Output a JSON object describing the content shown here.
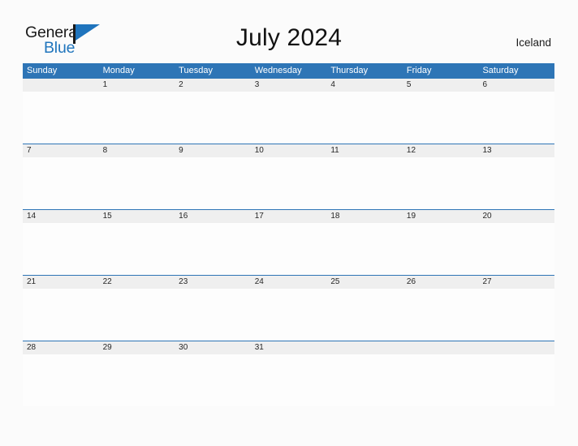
{
  "brand": {
    "name_top": "General",
    "name_bottom": "Blue",
    "flag_icon": "flag-triangle-icon",
    "accent_color": "#1f74bd",
    "dark_color": "#1a1a1a"
  },
  "header": {
    "title": "July 2024",
    "country": "Iceland"
  },
  "theme": {
    "header_blue": "#2e75b6",
    "date_band_gray": "#efefef",
    "page_background": "#fbfbfb",
    "cell_background": "#fdfdfd",
    "text_color": "#262626"
  },
  "calendar": {
    "month": "July",
    "year": "2024",
    "weekdays": [
      "Sunday",
      "Monday",
      "Tuesday",
      "Wednesday",
      "Thursday",
      "Friday",
      "Saturday"
    ],
    "weeks": [
      [
        "",
        "1",
        "2",
        "3",
        "4",
        "5",
        "6"
      ],
      [
        "7",
        "8",
        "9",
        "10",
        "11",
        "12",
        "13"
      ],
      [
        "14",
        "15",
        "16",
        "17",
        "18",
        "19",
        "20"
      ],
      [
        "21",
        "22",
        "23",
        "24",
        "25",
        "26",
        "27"
      ],
      [
        "28",
        "29",
        "30",
        "31",
        "",
        "",
        ""
      ]
    ]
  }
}
